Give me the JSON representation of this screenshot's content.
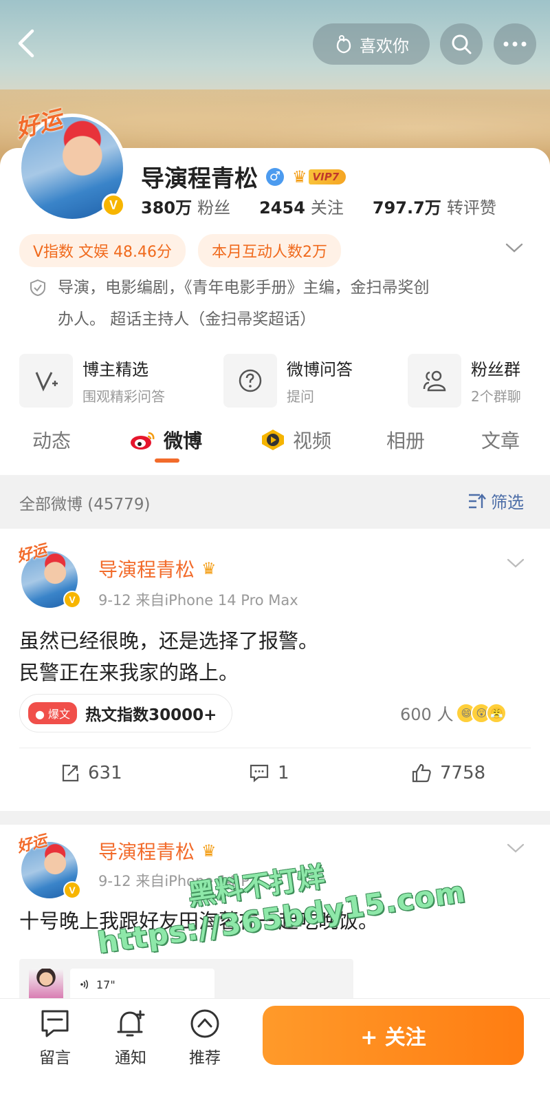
{
  "header": {
    "like_label": "喜欢你",
    "luck_badge": "好运"
  },
  "profile": {
    "name": "导演程青松",
    "vip_label": "VIP7",
    "verified_mark": "V",
    "stats": [
      {
        "value": "380万",
        "label": "粉丝"
      },
      {
        "value": "2454",
        "label": "关注"
      },
      {
        "value": "797.7万",
        "label": "转评赞"
      }
    ],
    "tags": [
      "V指数 文娱 48.46分",
      "本月互动人数2万"
    ],
    "bio_line1": "导演，电影编剧，《青年电影手册》主编，金扫帚奖创",
    "bio_line2": "办人。 超话主持人（金扫帚奖超话）"
  },
  "features": [
    {
      "title": "博主精选",
      "sub": "围观精彩问答"
    },
    {
      "title": "微博问答",
      "sub": "提问"
    },
    {
      "title": "粉丝群",
      "sub": "2个群聊"
    }
  ],
  "tabs": [
    "动态",
    "微博",
    "视频",
    "相册",
    "文章"
  ],
  "filter": {
    "title": "全部微博 (45779)",
    "button": "筛选"
  },
  "posts": [
    {
      "author": "导演程青松",
      "meta": "9-12  来自iPhone 14 Pro Max",
      "line1": "虽然已经很晚，还是选择了报警。",
      "line2": "民警正在来我家的路上。",
      "hot_badge": "爆文",
      "hot_text": "热文指数30000+",
      "reactions": "600 人",
      "reposts": "631",
      "comments": "1",
      "likes": "7758"
    },
    {
      "author": "导演程青松",
      "meta": "9-12  来自iPhone 14 P",
      "line1": "十号晚上我跟好友田海蓉在一起吃晚饭。",
      "audio_length": "17\""
    }
  ],
  "watermark": {
    "line1": "黑料不打烊",
    "line2": "https://365bdy15.com"
  },
  "bottom": {
    "items": [
      "留言",
      "通知",
      "推荐"
    ],
    "follow": "+ 关注"
  },
  "colors": {
    "accent": "#f26b2b",
    "follow_button": "#ff8a1e",
    "filter_blue": "#4d6ea8",
    "hot_red": "#f04f4a"
  }
}
